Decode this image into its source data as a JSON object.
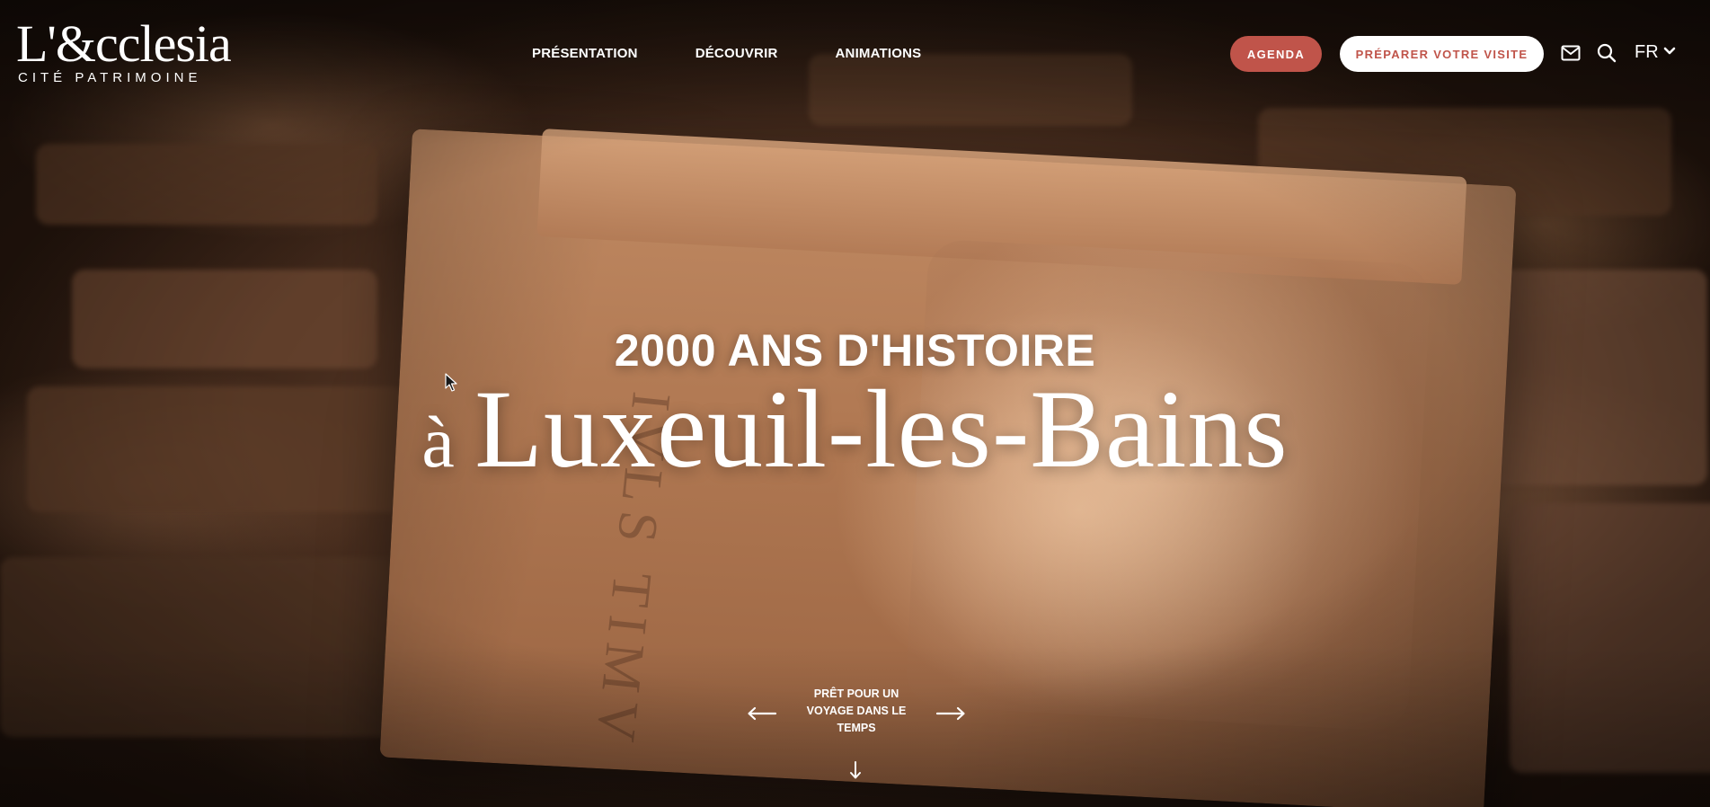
{
  "logo": {
    "main": "L'&cclesia",
    "sub": "CITÉ PATRIMOINE"
  },
  "nav": {
    "items": [
      {
        "label": "PRÉSENTATION"
      },
      {
        "label": "DÉCOUVRIR"
      },
      {
        "label": "ANIMATIONS"
      }
    ]
  },
  "header": {
    "agenda_label": "AGENDA",
    "visit_label": "PRÉPARER VOTRE VISITE",
    "lang_label": "FR",
    "icons": [
      "mail-icon",
      "search-icon",
      "chevron-down-icon"
    ]
  },
  "hero": {
    "kicker": "2000 ANS D'HISTOIRE",
    "title_prefix": "à ",
    "title": "Luxeuil-les-Bains"
  },
  "slider": {
    "text": "PRÊT POUR UN VOYAGE DANS LE TEMPS",
    "icons": [
      "arrow-left-icon",
      "arrow-right-icon",
      "arrow-down-icon"
    ]
  },
  "colors": {
    "accent": "#c0544a",
    "text": "#ffffff"
  }
}
